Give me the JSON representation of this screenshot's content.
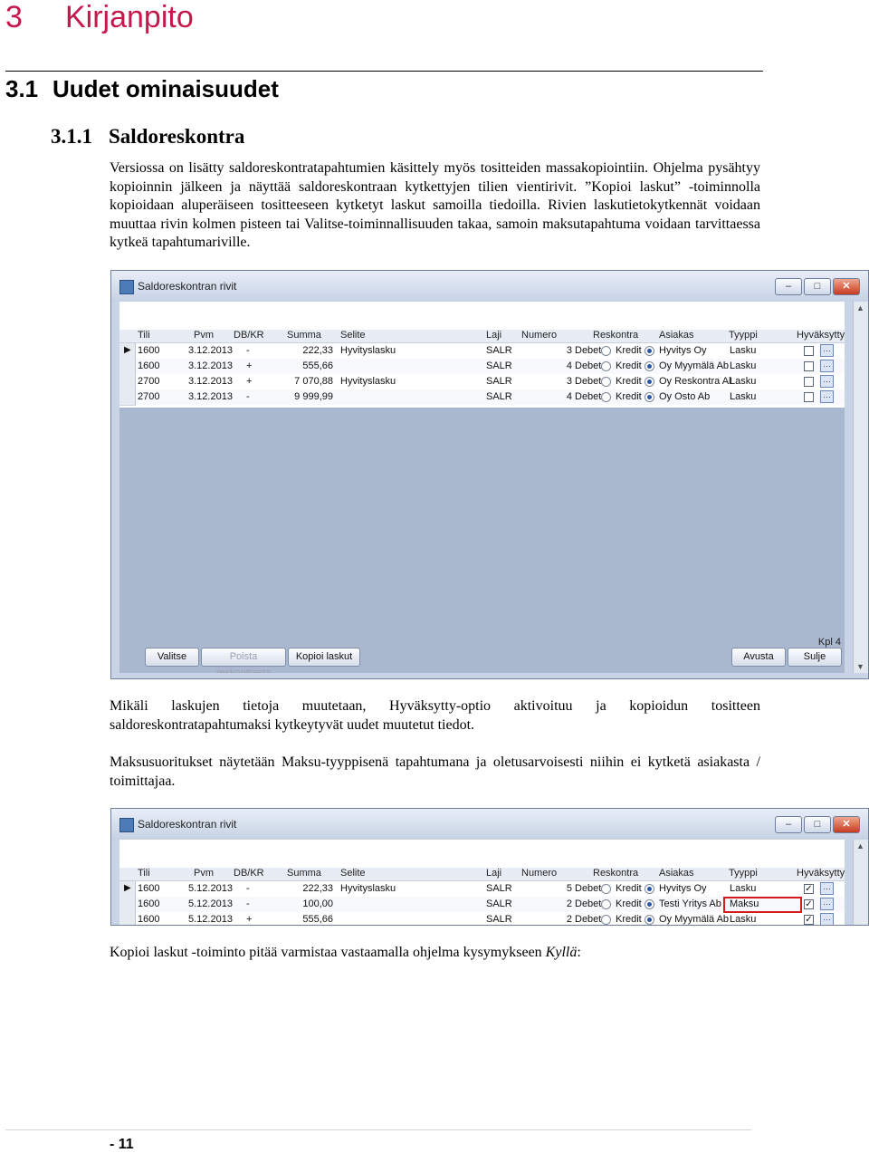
{
  "heading1": {
    "number": "3",
    "title": "Kirjanpito"
  },
  "heading2": {
    "number": "3.1",
    "title": "Uudet ominaisuudet"
  },
  "heading3": {
    "number": "3.1.1",
    "title": "Saldoreskontra"
  },
  "paragraphs": [
    "Versiossa on lisätty saldoreskontratapahtumien käsittely myös tositteiden massakopiointiin. Ohjelma pysähtyy kopioinnin jälkeen ja näyttää saldoreskontraan kytkettyjen tilien vientirivit. ”Kopioi laskut” -toiminnolla kopioidaan aluperäiseen tositteeseen kytketyt laskut samoilla tiedoilla. Rivien laskutietokytkennät voidaan muuttaa rivin kolmen pisteen tai Valitse-toiminnallisuuden takaa, samoin maksutapahtuma voidaan tarvittaessa kytkeä tapahtumariville.",
    "Mikäli laskujen tietoja muutetaan, Hyväksytty-optio aktivoituu ja kopioidun tositteen saldoreskontratapahtumaksi kytkeytyvät uudet muutetut tiedot.",
    "Maksusuoritukset näytetään Maksu-tyyppisenä tapahtumana ja oletusarvoisesti niihin ei kytketä asiakasta / toimittajaa."
  ],
  "final_text": "Kopioi laskut -toiminto pitää varmistaa vastaamalla ohjelma kysymykseen ",
  "final_text_em": "Kyllä",
  "final_text_end": ":",
  "window1": {
    "title": "Saldoreskontran rivit",
    "columns": [
      "Tili",
      "Pvm",
      "DB/KR",
      "Summa",
      "Selite",
      "Laji",
      "Numero",
      "Reskontra",
      "Asiakas",
      "Tyyppi",
      "Hyväksytty"
    ],
    "rows": [
      {
        "tili": "1600",
        "pvm": "3.12.2013",
        "dbkr": "-",
        "summa": "222,33",
        "selite": "Hyvityslasku",
        "laji": "SALR",
        "numero": "3",
        "debet": "Debet",
        "kredit": "Kredit",
        "asiakas": "Hyvitys Oy",
        "tyyppi": "Lasku",
        "kredit_on": true,
        "checked": false
      },
      {
        "tili": "1600",
        "pvm": "3.12.2013",
        "dbkr": "+",
        "summa": "555,66",
        "selite": "",
        "laji": "SALR",
        "numero": "4",
        "debet": "Debet",
        "kredit": "Kredit",
        "asiakas": "Oy Myymälä Ab",
        "tyyppi": "Lasku",
        "kredit_on": true,
        "checked": false
      },
      {
        "tili": "2700",
        "pvm": "3.12.2013",
        "dbkr": "+",
        "summa": "7 070,88",
        "selite": "Hyvityslasku",
        "laji": "SALR",
        "numero": "3",
        "debet": "Debet",
        "kredit": "Kredit",
        "asiakas": "Oy Reskontra Al",
        "tyyppi": "Lasku",
        "kredit_on": true,
        "checked": false
      },
      {
        "tili": "2700",
        "pvm": "3.12.2013",
        "dbkr": "-",
        "summa": "9 999,99",
        "selite": "",
        "laji": "SALR",
        "numero": "4",
        "debet": "Debet",
        "kredit": "Kredit",
        "asiakas": "Oy Osto Ab",
        "tyyppi": "Lasku",
        "kredit_on": true,
        "checked": false
      }
    ],
    "count_label": "Kpl",
    "count": "4",
    "buttons": {
      "valitse": "Valitse",
      "poista": "Poista reskontrasta",
      "kopioi": "Kopioi laskut",
      "avusta": "Avusta",
      "sulje": "Sulje"
    }
  },
  "window2": {
    "title": "Saldoreskontran rivit",
    "columns": [
      "Tili",
      "Pvm",
      "DB/KR",
      "Summa",
      "Selite",
      "Laji",
      "Numero",
      "Reskontra",
      "Asiakas",
      "Tyyppi",
      "Hyväksytty"
    ],
    "rows": [
      {
        "tili": "1600",
        "pvm": "5.12.2013",
        "dbkr": "-",
        "summa": "222,33",
        "selite": "Hyvityslasku",
        "laji": "SALR",
        "numero": "5",
        "debet": "Debet",
        "kredit": "Kredit",
        "asiakas": "Hyvitys Oy",
        "tyyppi": "Lasku",
        "kredit_on": true,
        "checked": true
      },
      {
        "tili": "1600",
        "pvm": "5.12.2013",
        "dbkr": "-",
        "summa": "100,00",
        "selite": "",
        "laji": "SALR",
        "numero": "2",
        "debet": "Debet",
        "kredit": "Kredit",
        "asiakas": "Testi Yritys Ab",
        "tyyppi": "Maksu",
        "kredit_on": true,
        "checked": true,
        "highlight": true
      },
      {
        "tili": "1600",
        "pvm": "5.12.2013",
        "dbkr": "+",
        "summa": "555,66",
        "selite": "",
        "laji": "SALR",
        "numero": "2",
        "debet": "Debet",
        "kredit": "Kredit",
        "asiakas": "Oy Myymälä Ab",
        "tyyppi": "Lasku",
        "kredit_on": true,
        "checked": true
      }
    ]
  },
  "footer": {
    "page": "- 11"
  },
  "colors": {
    "heading1": "#c8174b",
    "highlight_box": "#d51a1a"
  }
}
